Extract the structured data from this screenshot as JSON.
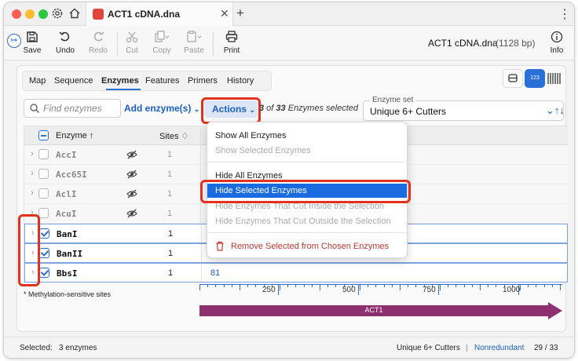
{
  "window": {
    "tab_title": "ACT1 cDNA.dna",
    "traffic_colors": [
      "#ff5f57",
      "#febc2e",
      "#28c840"
    ]
  },
  "toolbar": {
    "buttons": [
      {
        "label": "Save",
        "icon": "save-icon",
        "enabled": true
      },
      {
        "label": "Undo",
        "icon": "undo-icon",
        "enabled": true
      },
      {
        "label": "Redo",
        "icon": "redo-icon",
        "enabled": false
      },
      {
        "label": "Cut",
        "icon": "scissors-icon",
        "enabled": false
      },
      {
        "label": "Copy",
        "icon": "copy-icon",
        "enabled": false
      },
      {
        "label": "Paste",
        "icon": "paste-icon",
        "enabled": false
      },
      {
        "label": "Print",
        "icon": "printer-icon",
        "enabled": true
      }
    ],
    "file_name": "ACT1 cDNA.dna",
    "file_length": "(1128 bp)",
    "info_label": "Info"
  },
  "view_tabs": {
    "items": [
      "Map",
      "Sequence",
      "Enzymes",
      "Features",
      "Primers",
      "History"
    ],
    "active": "Enzymes",
    "mode_button_label": "123"
  },
  "controls": {
    "search_placeholder": "Find enzymes",
    "add_enzyme_label": "Add enzyme(s)",
    "actions_label": "Actions",
    "selection_count_num": "3",
    "selection_count_mid": " of ",
    "selection_count_total": "33",
    "selection_count_suffix": " Enzymes selected",
    "enzyme_set_legend": "Enzyme set",
    "enzyme_set_value": "Unique 6+ Cutters"
  },
  "table": {
    "header_enzyme": "Enzyme ↑",
    "header_sites": "Sites ♢",
    "rows": [
      {
        "name": "AccI",
        "sites": "1",
        "selected": false,
        "hidden_eye": true,
        "position": ""
      },
      {
        "name": "Acc65I",
        "sites": "1",
        "selected": false,
        "hidden_eye": true,
        "position": ""
      },
      {
        "name": "AclI",
        "sites": "1",
        "selected": false,
        "hidden_eye": true,
        "position": ""
      },
      {
        "name": "AcuI",
        "sites": "1",
        "selected": false,
        "hidden_eye": true,
        "position": ""
      },
      {
        "name": "BanI",
        "sites": "1",
        "selected": true,
        "hidden_eye": false,
        "position": ""
      },
      {
        "name": "BanII",
        "sites": "1",
        "selected": true,
        "hidden_eye": false,
        "position": ""
      },
      {
        "name": "BbsI",
        "sites": "1",
        "selected": true,
        "hidden_eye": false,
        "position": "81"
      }
    ],
    "methylation_note": "* Methylation-sensitive sites"
  },
  "ruler": {
    "labels": [
      "250",
      "500",
      "750",
      "1000"
    ],
    "feature_label": "ACT1",
    "feature_color": "#8e2f6f"
  },
  "actions_menu": {
    "items": [
      {
        "label": "Show All Enzymes",
        "enabled": true
      },
      {
        "label": "Show Selected Enzymes",
        "enabled": false
      },
      {
        "label": "Hide All Enzymes",
        "enabled": true
      },
      {
        "label": "Hide Selected Enzymes",
        "enabled": true,
        "highlighted": true
      },
      {
        "label": "Hide Enzymes That Cut Inside the Selection",
        "enabled": false
      },
      {
        "label": "Hide Enzymes That Cut Outside the Selection",
        "enabled": false
      },
      {
        "label": "Remove Selected from Chosen Enzymes",
        "enabled": true,
        "destructive": true
      }
    ],
    "highlight_color": "#1a6be0"
  },
  "status_bar": {
    "selected_label": "Selected:",
    "selected_value": "3 enzymes",
    "enzyme_set": "Unique 6+ Cutters",
    "separator": "|",
    "mode": "Nonredundant",
    "count": "29 / 33"
  },
  "annotation_color": "#e2321f"
}
